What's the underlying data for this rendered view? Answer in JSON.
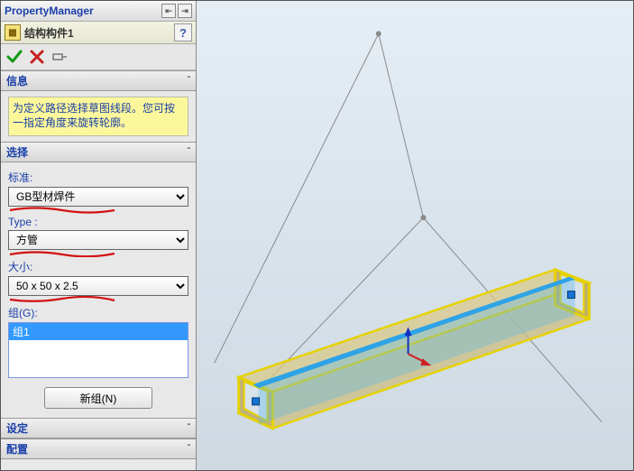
{
  "pm": {
    "title": "PropertyManager",
    "feature_name": "结构构件1",
    "help_char": "?"
  },
  "sections": {
    "info": {
      "title": "信息",
      "message": "为定义路径选择草图线段。您可按一指定角度来旋转轮廓。"
    },
    "select": {
      "title": "选择",
      "standard_label": "标准:",
      "standard_value": "GB型材焊件",
      "type_label": "Type :",
      "type_value": "方管",
      "size_label": "大小:",
      "size_value": "50 x 50 x 2.5",
      "group_label": "组(G):",
      "group_item": "组1",
      "new_group_label": "新组(N)"
    },
    "settings": {
      "title": "设定"
    },
    "config": {
      "title": "配置"
    }
  }
}
